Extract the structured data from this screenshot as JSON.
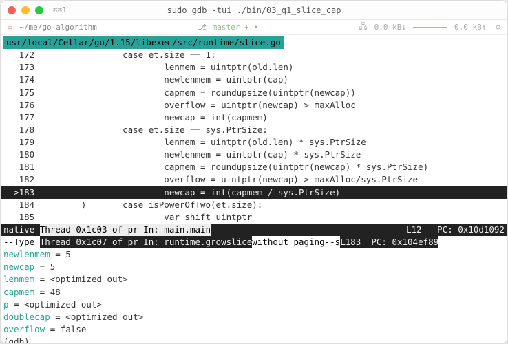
{
  "titlebar": {
    "shortcut": "⌘⌘1",
    "title": "sudo gdb -tui ./bin/03_q1_slice_cap"
  },
  "statusbar": {
    "path": "~/me/go-algorithm",
    "branch": "master + •",
    "net_down": "0.0 kB↓",
    "net_up": "0.0 kB↑",
    "gear": "⊙"
  },
  "source": {
    "path": "usr/local/Cellar/go/1.15/libexec/src/runtime/slice.go",
    "lines": [
      {
        "num": "172",
        "pre": "   ",
        "text": "                case et.size == 1:"
      },
      {
        "num": "173",
        "pre": "   ",
        "text": "                        lenmem = uintptr(old.len)"
      },
      {
        "num": "174",
        "pre": "   ",
        "text": "                        newlenmem = uintptr(cap)"
      },
      {
        "num": "175",
        "pre": "   ",
        "text": "                        capmem = roundupsize(uintptr(newcap))"
      },
      {
        "num": "176",
        "pre": "   ",
        "text": "                        overflow = uintptr(newcap) > maxAlloc"
      },
      {
        "num": "177",
        "pre": "   ",
        "text": "                        newcap = int(capmem)"
      },
      {
        "num": "178",
        "pre": "   ",
        "text": "                case et.size == sys.PtrSize:"
      },
      {
        "num": "179",
        "pre": "   ",
        "text": "                        lenmem = uintptr(old.len) * sys.PtrSize"
      },
      {
        "num": "180",
        "pre": "   ",
        "text": "                        newlenmem = uintptr(cap) * sys.PtrSize"
      },
      {
        "num": "181",
        "pre": "   ",
        "text": "                        capmem = roundupsize(uintptr(newcap) * sys.PtrSize)"
      },
      {
        "num": "182",
        "pre": "   ",
        "text": "                        overflow = uintptr(newcap) > maxAlloc/sys.PtrSize"
      },
      {
        "num": "183",
        "pre": "  >",
        "text": "                        newcap = int(capmem / sys.PtrSize)",
        "current": true
      },
      {
        "num": "184",
        "pre": "   ",
        "text": "        )       case isPowerOfTwo(et.size):"
      },
      {
        "num": "185",
        "pre": "   ",
        "text": "                        var shift uintptr"
      }
    ]
  },
  "threads": {
    "native_prefix": "native ",
    "native_hl": "Thread 0x1c03 of pr In: main.main",
    "native_right": "L12   PC: 0x10d1092",
    "type_prefix": "--Type ",
    "type_hl1": "Thread 0x1c07 of pr In: runtime.growslice",
    "type_mid": "without paging--s",
    "type_right_hl": "L183  PC: 0x104ef89"
  },
  "vars": [
    {
      "name": "newlenmem",
      "value": " = 5"
    },
    {
      "name": "newcap",
      "value": " = 5"
    },
    {
      "name": "lenmem",
      "value": " = <optimized out>"
    },
    {
      "name": "capmem",
      "value": " = 48"
    },
    {
      "name": "p",
      "value": " = <optimized out>"
    },
    {
      "name": "doublecap",
      "value": " = <optimized out>"
    },
    {
      "name": "overflow",
      "value": " = false"
    }
  ],
  "prompt": "(gdb) "
}
